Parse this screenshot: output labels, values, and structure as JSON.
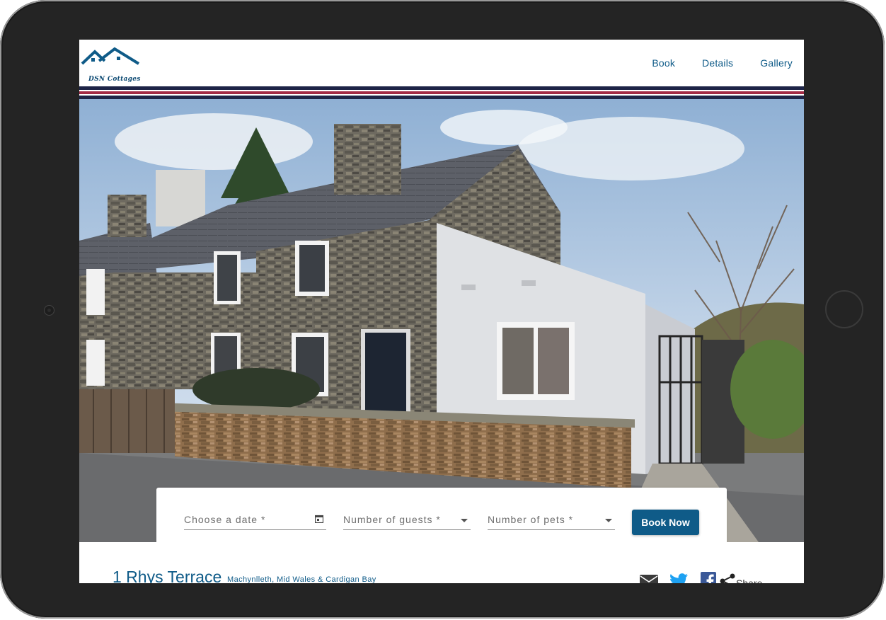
{
  "brand": {
    "logo_text": "DSN Cottages",
    "primary_color": "#0f5b88"
  },
  "nav": {
    "items": [
      {
        "label": "Book"
      },
      {
        "label": "Details"
      },
      {
        "label": "Gallery"
      }
    ]
  },
  "accent_stripes": [
    "#1d2447",
    "#a32a45",
    "#1d2447",
    "#a32a45",
    "#1d2447"
  ],
  "hero": {
    "image": "stone terraced cottage with white rendered extension"
  },
  "booking": {
    "date_placeholder": "Choose a date *",
    "guests_placeholder": "Number of guests *",
    "pets_placeholder": "Number of pets *",
    "book_button": "Book Now",
    "icons": {
      "date": "calendar-icon",
      "dropdown": "dropdown-caret-icon"
    }
  },
  "property": {
    "name": "1 Rhys Terrace",
    "location": "Machynlleth, Mid Wales & Cardigan Bay"
  },
  "share": {
    "icons": [
      "email-icon",
      "twitter-icon",
      "facebook-icon",
      "share-icon"
    ],
    "label": "Share"
  }
}
